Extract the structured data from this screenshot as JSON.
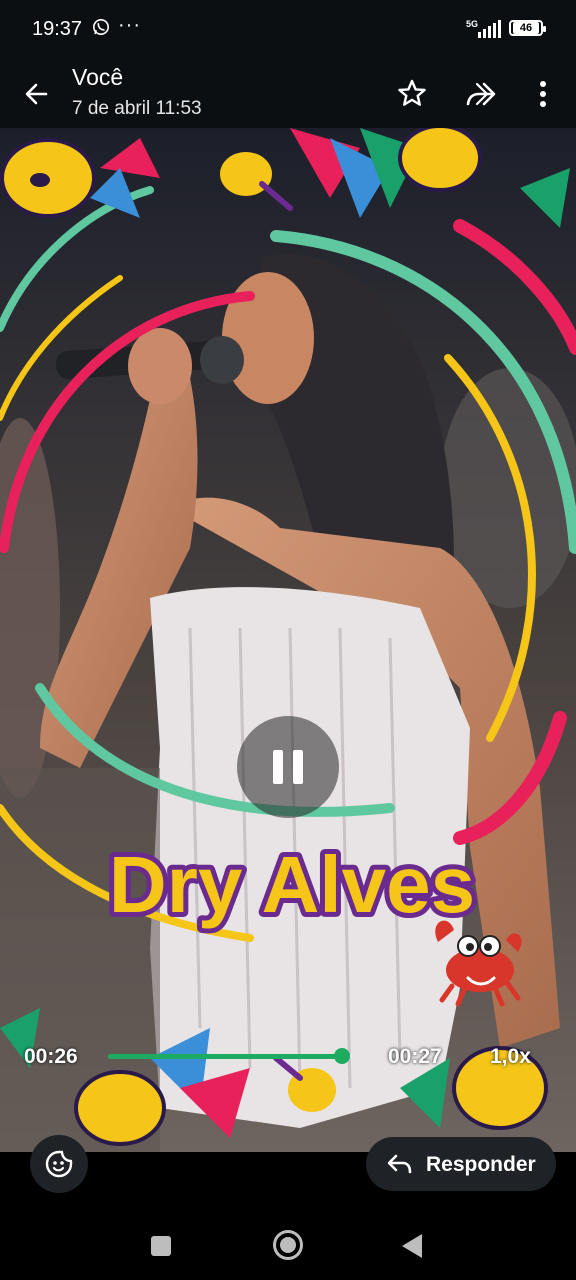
{
  "status_bar": {
    "time": "19:37",
    "notification_icons": [
      "whatsapp-icon",
      "more-dots-icon"
    ],
    "dots": "···",
    "network": "5G",
    "battery": "46"
  },
  "app_bar": {
    "title": "Você",
    "subtitle": "7 de abril 11:53",
    "icons": [
      "arrow-left-icon",
      "star-icon",
      "forward-icon",
      "more-vert-icon"
    ]
  },
  "video": {
    "overlay_text": "Dry Alves",
    "current_time": "00:26",
    "total_time": "00:27",
    "progress": 0.96,
    "speed": "1,0x",
    "state": "playing",
    "colors": {
      "accent": "#1daa61",
      "brand_fill": "#f5c518",
      "brand_outline": "#6a2a8f"
    }
  },
  "actions": {
    "reply_label": "Responder",
    "sticker_icon": "sticker-smile-icon"
  },
  "nav_bar": {
    "icons": [
      "recents-square-icon",
      "home-circle-icon",
      "back-triangle-icon"
    ]
  }
}
